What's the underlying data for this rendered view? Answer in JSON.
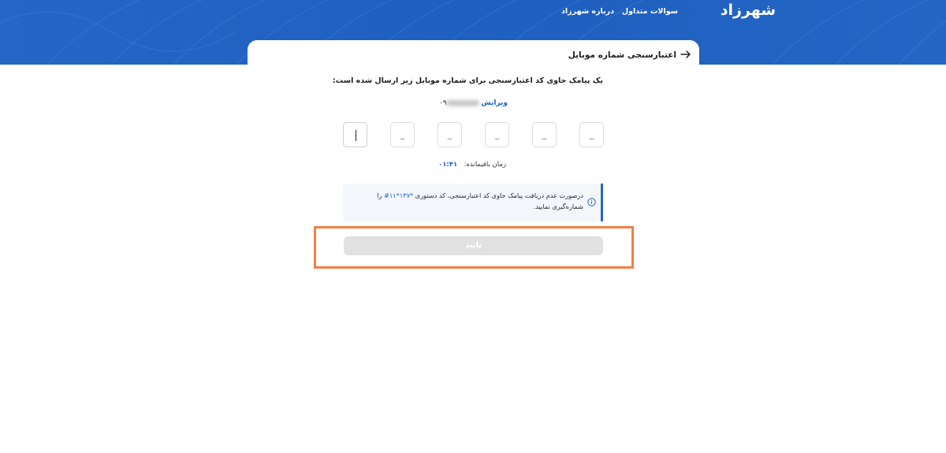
{
  "header": {
    "logo_text": "شهرزاد",
    "nav": {
      "faq_label": "سوالات متداول",
      "about_label": "درباره شهرزاد"
    }
  },
  "verification": {
    "title": "اعتبارسنجی شماره موبایل",
    "back_icon": "arrow-right-icon",
    "instruction": "یک پیامک حاوی کد اعتبارسنجی برای شماره موبایل زیر ارسال شده است:",
    "edit_label": "ویرایش",
    "phone_prefix": "۰۹",
    "otp_placeholder": "_",
    "otp_count": 6,
    "timer_label": "زمان باقیمانده:",
    "timer_value": "۰۱:۴۱",
    "info": {
      "icon": "info-circle-icon",
      "text_before": "درصورت عدم دریافت پیامک حاوی کد اعتبارسنجی، کد دستوری ",
      "ussd_code": "*۱۳۷*۱۱#",
      "text_after": " را شماره‌گیری نمایید."
    },
    "confirm_label": "تایید"
  },
  "colors": {
    "brand_blue": "#2467c6",
    "highlight": "#f07f45",
    "disabled_button": "#e1e1e1"
  }
}
